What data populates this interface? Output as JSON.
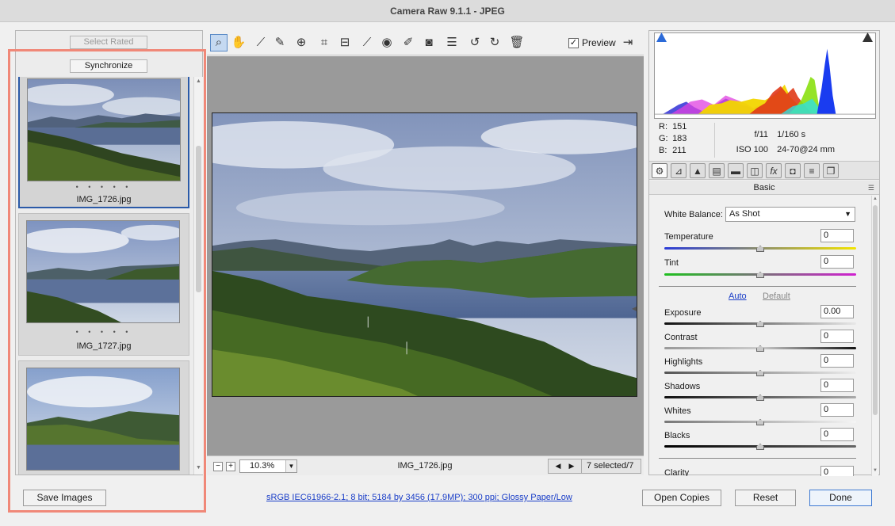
{
  "window": {
    "title": "Camera Raw 9.1.1  -  JPEG"
  },
  "filmstrip": {
    "select_rated": "Select Rated",
    "synchronize": "Synchronize",
    "items": [
      {
        "name": "IMG_1726.jpg",
        "rating": "• • • • •",
        "selected": true
      },
      {
        "name": "IMG_1727.jpg",
        "rating": "• • • • •",
        "selected": false
      },
      {
        "name": "",
        "rating": "",
        "selected": false
      }
    ]
  },
  "toolbar": {
    "tools": [
      "zoom-icon",
      "hand-icon",
      "eyedropper-icon",
      "color-sampler-icon",
      "target-adjust-icon",
      "crop-icon",
      "straighten-icon",
      "spot-removal-icon",
      "red-eye-icon",
      "adjustment-brush-icon",
      "graduated-filter-icon",
      "preferences-icon",
      "rotate-left-icon",
      "rotate-right-icon",
      "trash-icon"
    ],
    "preview_label": "Preview",
    "preview_checked": true
  },
  "status": {
    "zoom": "10.3%",
    "filename": "IMG_1726.jpg",
    "selected_count": "7 selected/7"
  },
  "readout": {
    "r_label": "R:",
    "r": "151",
    "g_label": "G:",
    "g": "183",
    "b_label": "B:",
    "b": "211",
    "aperture": "f/11",
    "shutter": "1/160 s",
    "iso": "ISO 100",
    "lens": "24-70@24 mm"
  },
  "panel": {
    "title": "Basic",
    "tabs": [
      "basic-tab-icon",
      "tone-curve-tab-icon",
      "detail-tab-icon",
      "hsl-tab-icon",
      "split-toning-tab-icon",
      "lens-tab-icon",
      "effects-tab-icon",
      "camera-calibration-tab-icon",
      "presets-tab-icon",
      "snapshots-tab-icon"
    ],
    "white_balance_label": "White Balance:",
    "white_balance_value": "As Shot",
    "auto": "Auto",
    "default": "Default",
    "sliders": [
      {
        "label": "Temperature",
        "value": "0"
      },
      {
        "label": "Tint",
        "value": "0"
      },
      {
        "label": "Exposure",
        "value": "0.00"
      },
      {
        "label": "Contrast",
        "value": "0"
      },
      {
        "label": "Highlights",
        "value": "0"
      },
      {
        "label": "Shadows",
        "value": "0"
      },
      {
        "label": "Whites",
        "value": "0"
      },
      {
        "label": "Blacks",
        "value": "0"
      },
      {
        "label": "Clarity",
        "value": "0"
      }
    ]
  },
  "bottom": {
    "save_images": "Save Images",
    "workflow_info": "sRGB IEC61966-2.1; 8 bit; 5184 by 3456 (17.9MP); 300 ppi; Glossy Paper/Low",
    "open_copies": "Open Copies",
    "reset": "Reset",
    "done": "Done"
  },
  "colors": {
    "accent": "#2b5aa8",
    "highlight_box": "#f08878",
    "link": "#1a3ec8"
  }
}
